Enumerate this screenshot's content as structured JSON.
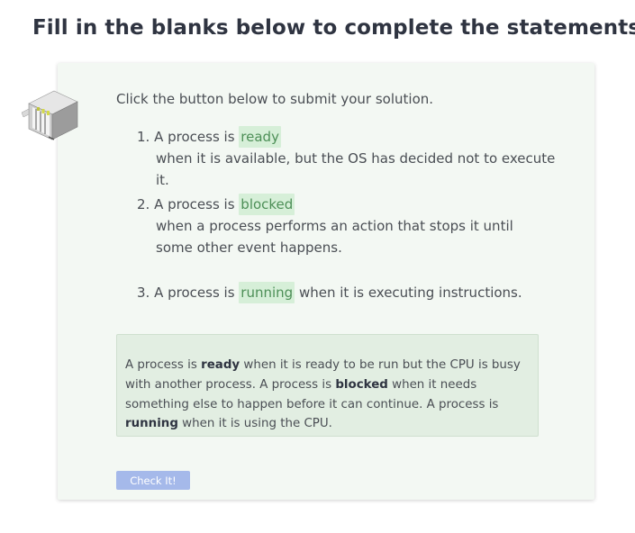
{
  "heading": "Fill in the blanks below to complete the statements",
  "intro": "Click the button below to submit your solution.",
  "questions": [
    {
      "number": "1.",
      "before": "A process is",
      "blank": "ready",
      "after": "when it is available, but the OS has decided not to execute it."
    },
    {
      "number": "2.",
      "before": "A process is",
      "blank": "blocked",
      "after": "when a process performs an action that stops it until some other event happens."
    },
    {
      "number": "3.",
      "before": "A process is",
      "blank": "running",
      "after": "when it is executing instructions."
    }
  ],
  "feedback": {
    "s1a": "A process is ",
    "s1b": "ready",
    "s1c": " when it is ready to be run but the CPU is busy with another process. A process is ",
    "s1d": "blocked",
    "s1e": " when it needs something else to happen before it can continue. A process is ",
    "s1f": "running",
    "s1g": " when it is using the CPU."
  },
  "check_button": "Check It!",
  "colors": {
    "card_bg": "#f3f8f3",
    "blank_bg": "#d6efd8",
    "blank_text": "#4d8f57",
    "feedback_bg": "#e2eee2",
    "button_bg": "#a5b9ea"
  },
  "icons": {
    "avatar": "server-rack-icon"
  }
}
